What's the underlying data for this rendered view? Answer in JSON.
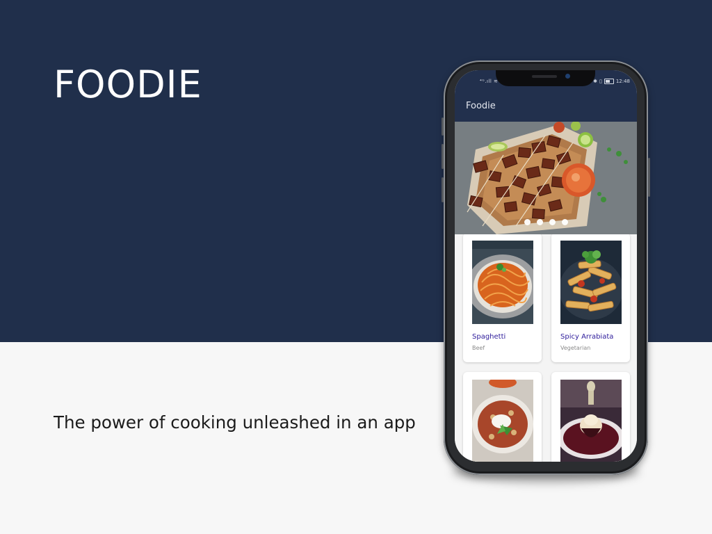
{
  "hero": {
    "title": "FOODIE",
    "tagline": "The power of cooking unleashed in an app"
  },
  "app": {
    "status_bar": {
      "time": "12:48"
    },
    "app_bar": {
      "title": "Foodie"
    },
    "carousel": {
      "slide_count": 4
    },
    "recipes": [
      {
        "name": "Spaghetti",
        "category": "Beef"
      },
      {
        "name": "Spicy Arrabiata",
        "category": "Vegetarian"
      },
      {
        "name": "",
        "category": ""
      },
      {
        "name": "",
        "category": ""
      }
    ]
  },
  "colors": {
    "navy": "#202f4b",
    "app_bar": "#22304d",
    "recipe_name": "#2c1a9a",
    "light_background": "#f7f7f7"
  }
}
